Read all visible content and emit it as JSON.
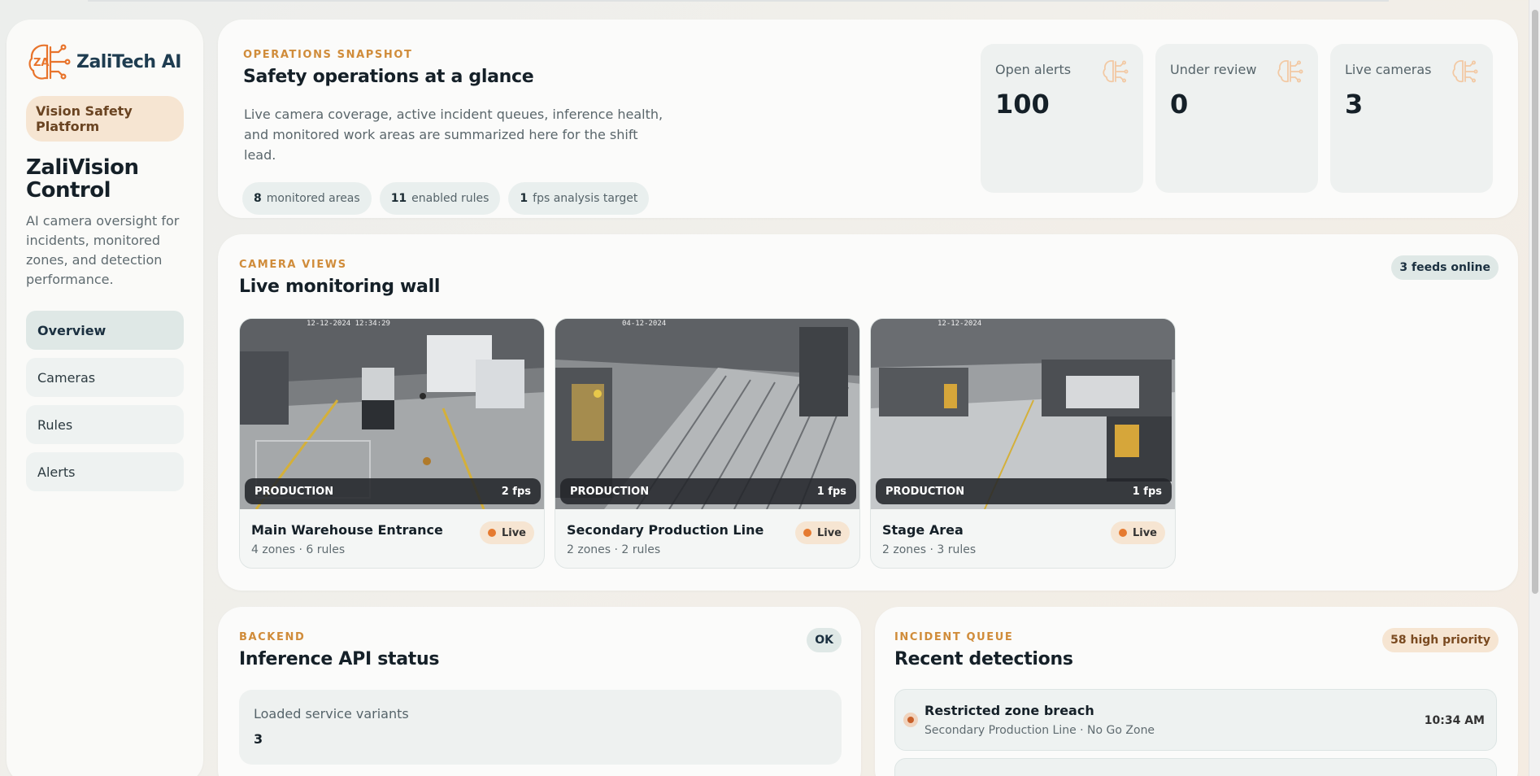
{
  "brand": {
    "name": "ZaliTech AI",
    "mark": "ZA"
  },
  "sidebar": {
    "platform": "Vision Safety Platform",
    "title": "ZaliVision Control",
    "description": "AI camera oversight for incidents, monitored zones, and detection performance.",
    "nav": [
      {
        "label": "Overview",
        "active": true
      },
      {
        "label": "Cameras",
        "active": false
      },
      {
        "label": "Rules",
        "active": false
      },
      {
        "label": "Alerts",
        "active": false
      }
    ]
  },
  "snapshot": {
    "eyebrow": "OPERATIONS SNAPSHOT",
    "title": "Safety operations at a glance",
    "description": "Live camera coverage, active incident queues, inference health, and monitored work areas are summarized here for the shift lead.",
    "chips": [
      {
        "value": "8",
        "label": "monitored areas"
      },
      {
        "value": "11",
        "label": "enabled rules"
      },
      {
        "value": "1",
        "label": "fps analysis target"
      }
    ],
    "stats": [
      {
        "label": "Open alerts",
        "value": "100",
        "icon": "brain-icon"
      },
      {
        "label": "Under review",
        "value": "0",
        "icon": "brain-icon"
      },
      {
        "label": "Live cameras",
        "value": "3",
        "icon": "brain-icon"
      }
    ]
  },
  "wall": {
    "eyebrow": "CAMERA VIEWS",
    "title": "Live monitoring wall",
    "badge": "3 feeds online",
    "cameras": [
      {
        "name": "Main Warehouse Entrance",
        "meta": "4 zones · 6 rules",
        "area": "PRODUCTION",
        "fps": "2 fps",
        "status": "Live",
        "stamp": "12-12-2024 12:34:29"
      },
      {
        "name": "Secondary Production Line",
        "meta": "2 zones · 2 rules",
        "area": "PRODUCTION",
        "fps": "1 fps",
        "status": "Live",
        "stamp": "04-12-2024"
      },
      {
        "name": "Stage Area",
        "meta": "2 zones · 3 rules",
        "area": "PRODUCTION",
        "fps": "1 fps",
        "status": "Live",
        "stamp": "12-12-2024"
      }
    ]
  },
  "backend": {
    "eyebrow": "BACKEND",
    "title": "Inference API status",
    "status": "OK",
    "variants_label": "Loaded service variants",
    "variants_value": "3"
  },
  "queue": {
    "eyebrow": "INCIDENT QUEUE",
    "title": "Recent detections",
    "badge": "58 high priority",
    "items": [
      {
        "title": "Restricted zone breach",
        "sub": "Secondary Production Line · No Go Zone",
        "time": "10:34 AM"
      }
    ]
  },
  "colors": {
    "accent": "#d08c3a",
    "brand": "#1e3c50",
    "live": "#e57a30",
    "logo_orange": "#e8742c"
  }
}
